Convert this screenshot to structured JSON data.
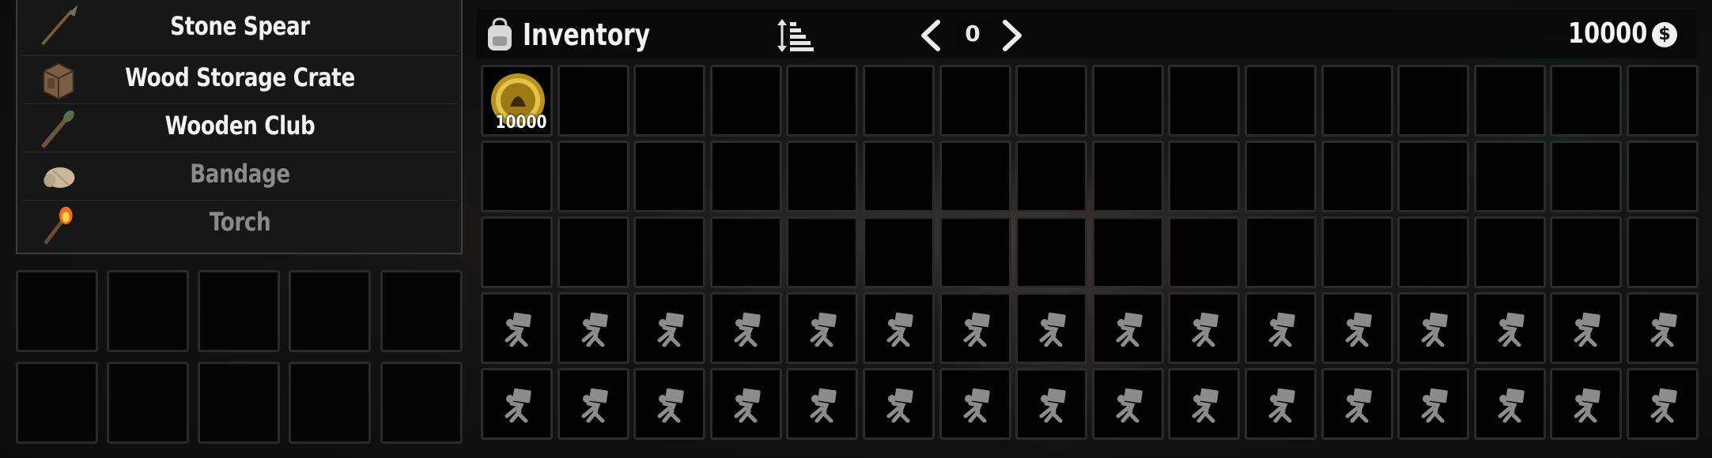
{
  "recipes": [
    {
      "name": "Stone Spear",
      "icon": "stone-spear-icon",
      "locked": false
    },
    {
      "name": "Wood Storage Crate",
      "icon": "wood-crate-icon",
      "locked": false
    },
    {
      "name": "Wooden Club",
      "icon": "wooden-club-icon",
      "locked": false
    },
    {
      "name": "Bandage",
      "icon": "bandage-icon",
      "locked": true
    },
    {
      "name": "Torch",
      "icon": "torch-icon",
      "locked": true
    }
  ],
  "inventory": {
    "title": "Inventory",
    "page": "0",
    "money": "10000",
    "money_icon": "dukes-coin-icon",
    "slots": [
      {
        "item": "Dukes Casino Token",
        "icon": "casino-coin-icon",
        "count": "10000"
      }
    ],
    "locked_slot_icon": "locked-slot-icon"
  },
  "colors": {
    "panel_bg": "#181818",
    "slot_bg": "#030303",
    "slot_border": "#2b2b2b",
    "locked_text": "#8a8a8a"
  }
}
